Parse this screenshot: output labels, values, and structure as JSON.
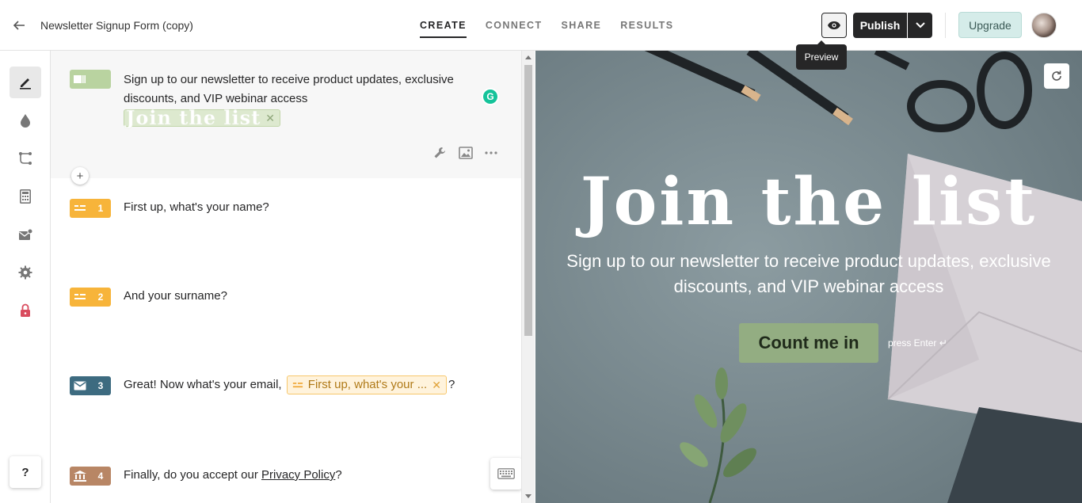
{
  "header": {
    "form_title": "Newsletter Signup Form (copy)",
    "tabs": [
      "CREATE",
      "CONNECT",
      "SHARE",
      "RESULTS"
    ],
    "active_tab": "CREATE",
    "preview_tooltip": "Preview",
    "publish_label": "Publish",
    "upgrade_label": "Upgrade"
  },
  "sidebar": {
    "items": [
      {
        "icon": "pencil-icon",
        "active": true
      },
      {
        "icon": "droplet-icon"
      },
      {
        "icon": "logic-branch-icon"
      },
      {
        "icon": "calculator-icon"
      },
      {
        "icon": "email-notification-icon"
      },
      {
        "icon": "gear-icon"
      },
      {
        "icon": "lock-icon"
      }
    ],
    "help_label": "?"
  },
  "questions": {
    "welcome": {
      "text": "Sign up to our newsletter to receive product updates, exclusive discounts, and VIP webinar access",
      "title_chip": "Join the list",
      "color": "#b9d3a0"
    },
    "items": [
      {
        "number": "1",
        "text": "First up, what's your name?",
        "color": "#f7b43a"
      },
      {
        "number": "2",
        "text": "And your surname?",
        "color": "#f7b43a"
      },
      {
        "number": "3",
        "text_before": "Great! Now what's your email,",
        "ref_chip": "First up, what's your ...",
        "text_after": "?",
        "color": "#3d6b80"
      },
      {
        "number": "4",
        "text_before": "Finally, do you accept our",
        "link": "Privacy Policy",
        "text_after": "?",
        "color": "#b88665"
      }
    ]
  },
  "preview": {
    "title": "Join the list",
    "subtitle": "Sign up to our newsletter to receive product updates, exclusive discounts, and VIP webinar access",
    "button_label": "Count me in",
    "press_enter": "press Enter ↵"
  }
}
